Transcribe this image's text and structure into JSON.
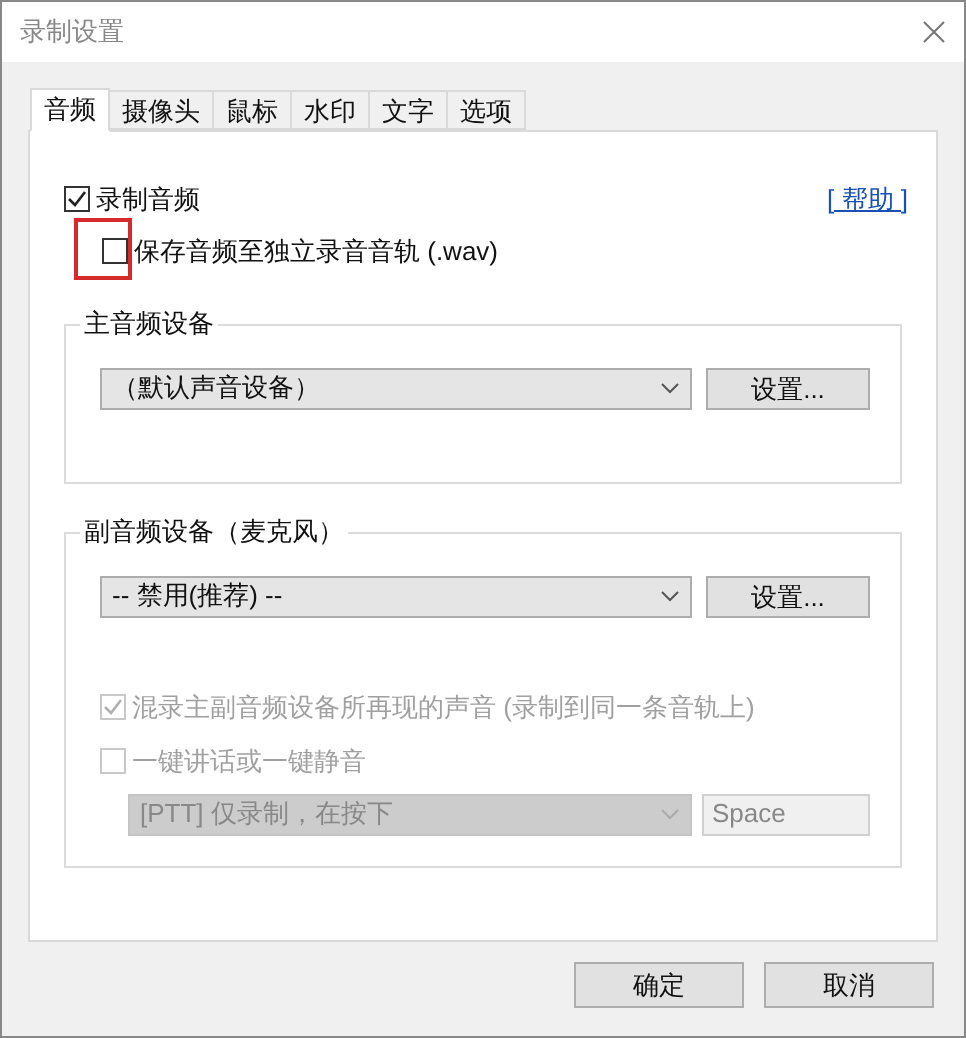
{
  "window": {
    "title": "录制设置"
  },
  "tabs": [
    {
      "label": "音频",
      "selected": true
    },
    {
      "label": "摄像头",
      "selected": false
    },
    {
      "label": "鼠标",
      "selected": false
    },
    {
      "label": "水印",
      "selected": false
    },
    {
      "label": "文字",
      "selected": false
    },
    {
      "label": "选项",
      "selected": false
    }
  ],
  "record_audio": {
    "label": "录制音频",
    "checked": true
  },
  "help_link": "[ 帮助 ]",
  "save_separate": {
    "label": "保存音频至独立录音音轨 (.wav)",
    "checked": false,
    "highlighted": true
  },
  "main_device": {
    "title": "主音频设备",
    "value": "（默认声音设备）",
    "button": "设置..."
  },
  "secondary_device": {
    "title": "副音频设备（麦克风）",
    "value": "-- 禁用(推荐) --",
    "button": "设置..."
  },
  "options": [
    {
      "label": "混录主副音频设备所再现的声音 (录制到同一条音轨上)",
      "checked": true,
      "disabled": true
    },
    {
      "label": "一键讲话或一键静音",
      "checked": false,
      "disabled": true
    }
  ],
  "ptt": {
    "value": "[PTT] 仅录制，在按下",
    "disabled": true,
    "key": "Space"
  },
  "buttons": [
    "确定",
    "取消"
  ]
}
